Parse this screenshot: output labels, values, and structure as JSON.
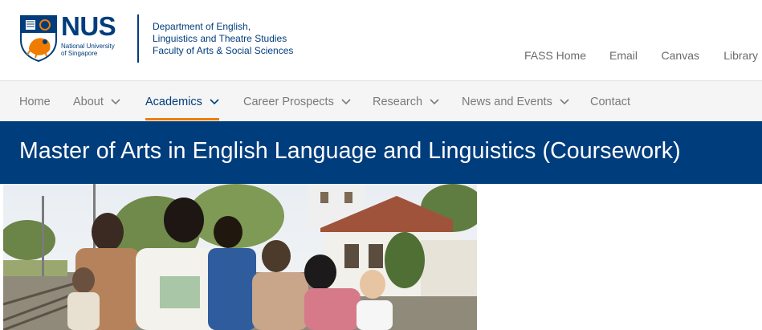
{
  "logo": {
    "wordmark": "NUS",
    "sub_line1": "National University",
    "sub_line2": "of Singapore",
    "crest_icon": "nus-crest-icon"
  },
  "department": {
    "line1": "Department of English,",
    "line2": "Linguistics and Theatre Studies",
    "line3": "Faculty of Arts & Social Sciences"
  },
  "utility_links": [
    {
      "label": "FASS Home"
    },
    {
      "label": "Email"
    },
    {
      "label": "Canvas"
    },
    {
      "label": "Library"
    }
  ],
  "nav": {
    "items": [
      {
        "label": "Home",
        "has_dropdown": false
      },
      {
        "label": "About",
        "has_dropdown": true
      },
      {
        "label": "Academics",
        "has_dropdown": true,
        "active": true
      },
      {
        "label": "Career Prospects",
        "has_dropdown": true
      },
      {
        "label": "Research",
        "has_dropdown": true
      },
      {
        "label": "News and Events",
        "has_dropdown": true
      },
      {
        "label": "Contact",
        "has_dropdown": false
      }
    ]
  },
  "page": {
    "title": "Master of Arts in English Language and Linguistics (Coursework)"
  },
  "colors": {
    "brand_blue": "#003d7c",
    "accent_orange": "#ef7c00",
    "nav_bg": "#f5f5f5",
    "nav_text": "#7a7a7a"
  }
}
